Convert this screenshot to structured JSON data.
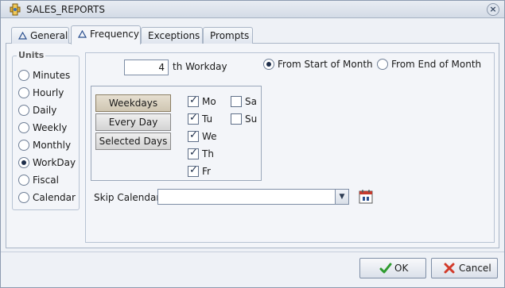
{
  "window": {
    "title": "SALES_REPORTS"
  },
  "tabs": [
    {
      "label": "General",
      "icon": "triangle-icon"
    },
    {
      "label": "Frequency",
      "icon": "triangle-icon",
      "active": true
    },
    {
      "label": "Exceptions"
    },
    {
      "label": "Prompts"
    }
  ],
  "units": {
    "legend": "Units",
    "options": [
      "Minutes",
      "Hourly",
      "Daily",
      "Weekly",
      "Monthly",
      "WorkDay",
      "Fiscal",
      "Calendar"
    ],
    "selected": "WorkDay"
  },
  "workday": {
    "value": "4",
    "label": "th Workday"
  },
  "anchor": {
    "options": [
      "From Start of Month",
      "From End of Month"
    ],
    "selected": "From Start of Month"
  },
  "frequency_buttons": {
    "weekdays": "Weekdays",
    "every_day": "Every Day",
    "selected_days": "Selected Days"
  },
  "days": [
    {
      "label": "Mo",
      "checked": true
    },
    {
      "label": "Tu",
      "checked": true
    },
    {
      "label": "We",
      "checked": true
    },
    {
      "label": "Th",
      "checked": true
    },
    {
      "label": "Fr",
      "checked": true
    },
    {
      "label": "Sa",
      "checked": false
    },
    {
      "label": "Su",
      "checked": false
    }
  ],
  "skip_calendar": {
    "label": "Skip Calendar",
    "value": ""
  },
  "actions": {
    "ok": "OK",
    "cancel": "Cancel"
  },
  "colors": {
    "accent": "#1e2e4a",
    "ok_check": "#2e9b2e",
    "cancel_x": "#d23a2a"
  }
}
